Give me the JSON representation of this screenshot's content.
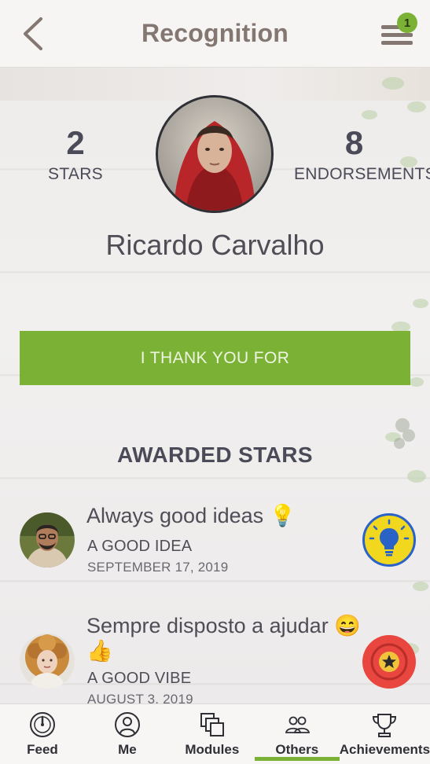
{
  "header": {
    "title": "Recognition",
    "menu_badge": "1"
  },
  "profile": {
    "stars_count": "2",
    "stars_label": "STARS",
    "endorsements_count": "8",
    "endorsements_label": "ENDORSEMENTS",
    "name": "Ricardo Carvalho"
  },
  "thank_button_label": "I THANK YOU FOR",
  "awarded_title": "AWARDED STARS",
  "stars": [
    {
      "title": "Always good ideas 💡",
      "category": "A GOOD IDEA",
      "date": "SEPTEMBER 17, 2019",
      "badge_icon": "lightbulb-icon",
      "badge_color": "#f2d71f"
    },
    {
      "title_line1": "Sempre disposto a ajudar 😄",
      "title_line2": "👍",
      "category": "A GOOD VIBE",
      "date": "AUGUST 3, 2019",
      "badge_icon": "star-icon",
      "badge_color": "#e8463f"
    }
  ],
  "nav": {
    "items": [
      {
        "label": "Feed",
        "icon": "gauge-icon"
      },
      {
        "label": "Me",
        "icon": "person-icon"
      },
      {
        "label": "Modules",
        "icon": "modules-icon"
      },
      {
        "label": "Others",
        "icon": "people-icon"
      },
      {
        "label": "Achievements",
        "icon": "trophy-icon"
      }
    ],
    "active": "Others"
  },
  "colors": {
    "accent": "#7bb134",
    "header_title": "#847670",
    "text": "#4a4a58"
  }
}
